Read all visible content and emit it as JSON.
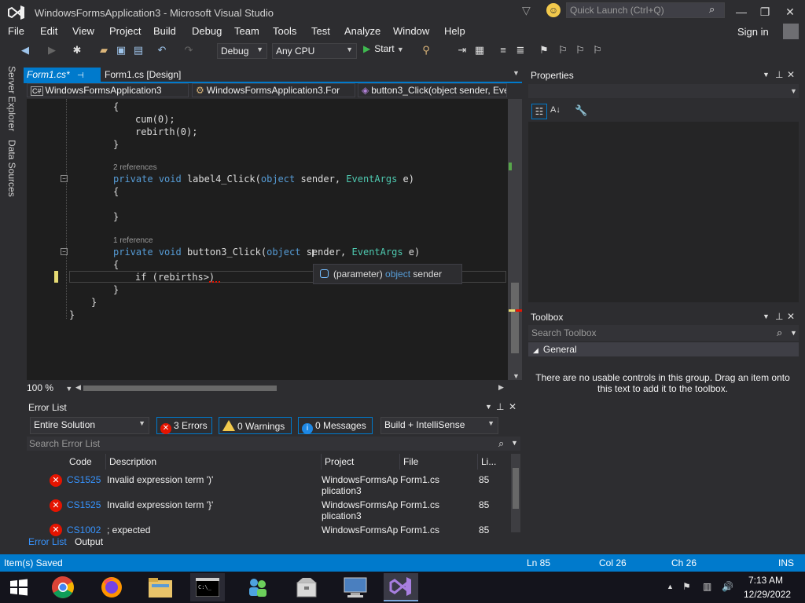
{
  "window": {
    "title": "WindowsFormsApplication3 - Microsoft Visual Studio",
    "quick_launch_placeholder": "Quick Launch (Ctrl+Q)"
  },
  "menu": [
    "File",
    "Edit",
    "View",
    "Project",
    "Build",
    "Debug",
    "Team",
    "Tools",
    "Test",
    "Analyze",
    "Window",
    "Help"
  ],
  "account": {
    "sign_in": "Sign in"
  },
  "toolbar": {
    "config": "Debug",
    "platform": "Any CPU",
    "start": "Start"
  },
  "left_sidebar": [
    "Server Explorer",
    "Data Sources"
  ],
  "doc_tabs": {
    "active": "Form1.cs*",
    "inactive": "Form1.cs [Design]"
  },
  "nav_bar": {
    "project": "WindowsFormsApplication3",
    "class": "WindowsFormsApplication3.For",
    "member": "button3_Click(object sender, Eve"
  },
  "code": {
    "line_open1": "{",
    "line_cum": "cum(0);",
    "line_rebirth": "rebirth(0);",
    "line_close1": "}",
    "refs_label4": "2 references",
    "label4_private": "private",
    "label4_void": "void",
    "label4_name": "label4_Click(",
    "label4_object": "object",
    "label4_sender": "sender,",
    "label4_eventargs": "EventArgs",
    "label4_e": "e)",
    "line_open2": "{",
    "line_close2": "}",
    "refs_button3": "1 reference",
    "button3_private": "private",
    "button3_void": "void",
    "button3_name": "button3_Click(",
    "button3_object": "object",
    "button3_sender": "sender,",
    "button3_eventargs": "EventArgs",
    "button3_e": "e)",
    "line_open3": "{",
    "line_if": "if (rebirths>)",
    "line_close3": "}",
    "line_close_class": "}",
    "line_close_ns": "}"
  },
  "tooltip": {
    "prefix": "(parameter)",
    "type": "object",
    "name": "sender"
  },
  "zoom": "100 %",
  "error_list": {
    "title": "Error List",
    "scope": "Entire Solution",
    "errors_btn": "3 Errors",
    "warnings_btn": "0 Warnings",
    "messages_btn": "0 Messages",
    "build_filter": "Build + IntelliSense",
    "search_placeholder": "Search Error List",
    "columns": {
      "code": "Code",
      "description": "Description",
      "project": "Project",
      "file": "File",
      "line": "Li..."
    },
    "rows": [
      {
        "code": "CS1525",
        "description": "Invalid expression term ')'",
        "project_line1": "WindowsFormsAp",
        "project_line2": "plication3",
        "file": "Form1.cs",
        "line": "85"
      },
      {
        "code": "CS1525",
        "description": "Invalid expression term '}'",
        "project_line1": "WindowsFormsAp",
        "project_line2": "plication3",
        "file": "Form1.cs",
        "line": "85"
      },
      {
        "code": "CS1002",
        "description": "; expected",
        "project_line1": "WindowsFormsAp",
        "project_line2": "",
        "file": "Form1.cs",
        "line": "85"
      }
    ]
  },
  "bottom_tabs": {
    "error_list": "Error List",
    "output": "Output"
  },
  "properties": {
    "title": "Properties"
  },
  "toolbox": {
    "title": "Toolbox",
    "search_placeholder": "Search Toolbox",
    "group": "General",
    "empty_message": "There are no usable controls in this group. Drag an item onto this text to add it to the toolbox."
  },
  "status": {
    "message": "Item(s) Saved",
    "ln": "Ln 85",
    "col": "Col 26",
    "ch": "Ch 26",
    "mode": "INS"
  },
  "clock": {
    "time": "7:13 AM",
    "date": "12/29/2022"
  },
  "colors": {
    "accent": "#007acc",
    "editor_bg": "#1e1e1e",
    "keyword": "#569cd6",
    "type": "#4ec9b0",
    "error": "#e51400"
  }
}
